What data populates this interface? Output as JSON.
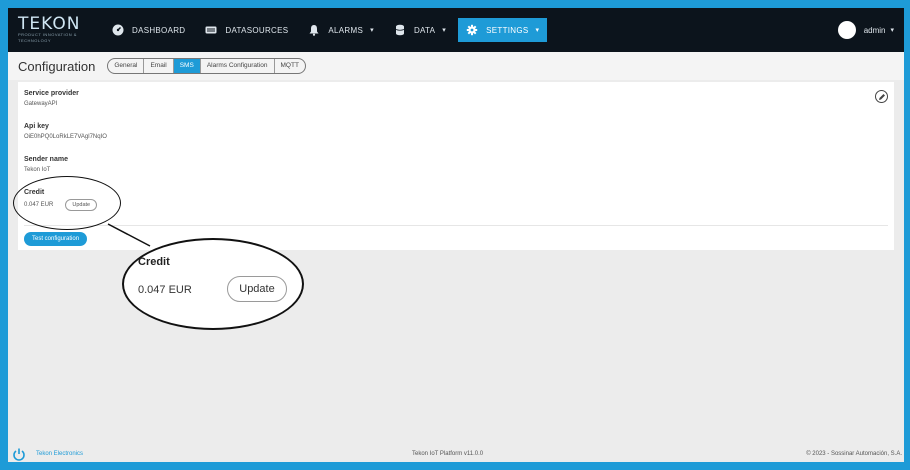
{
  "brand": {
    "logo": "TEKON",
    "tagline": "PRODUCT INNOVATION & TECHNOLOGY"
  },
  "nav": {
    "items": [
      {
        "label": "DASHBOARD",
        "icon": "dashboard-icon",
        "caret": ""
      },
      {
        "label": "DATASOURCES",
        "icon": "datasources-icon",
        "caret": ""
      },
      {
        "label": "ALARMS",
        "icon": "bell-icon",
        "caret": "▾"
      },
      {
        "label": "DATA",
        "icon": "database-icon",
        "caret": "▾"
      },
      {
        "label": "SETTINGS",
        "icon": "gear-icon",
        "caret": "▾"
      }
    ],
    "user": "admin",
    "user_caret": "▾"
  },
  "page": {
    "title": "Configuration",
    "tabs": [
      "General",
      "Email",
      "SMS",
      "Alarms Configuration",
      "MQTT"
    ],
    "active_tab": "SMS"
  },
  "sms": {
    "service_provider": {
      "label": "Service provider",
      "value": "GatewayAPI"
    },
    "api_key": {
      "label": "Api key",
      "value": "OiE0hPQ0LoRkLE7VAgl7NqIO"
    },
    "sender_name": {
      "label": "Sender name",
      "value": "Tekon IoT"
    },
    "credit": {
      "label": "Credit",
      "value": "0.047 EUR",
      "update_label": "Update"
    },
    "test_button": "Test configuration"
  },
  "zoom": {
    "label": "Credit",
    "value": "0.047 EUR",
    "update_label": "Update"
  },
  "footer": {
    "left": "Tekon Electronics",
    "center": "Tekon IoT Platform v11.0.0",
    "right": "© 2023 - Sossinar Automación, S.A."
  },
  "colors": {
    "accent": "#1e9bd7",
    "navbar": "#0c141c"
  }
}
